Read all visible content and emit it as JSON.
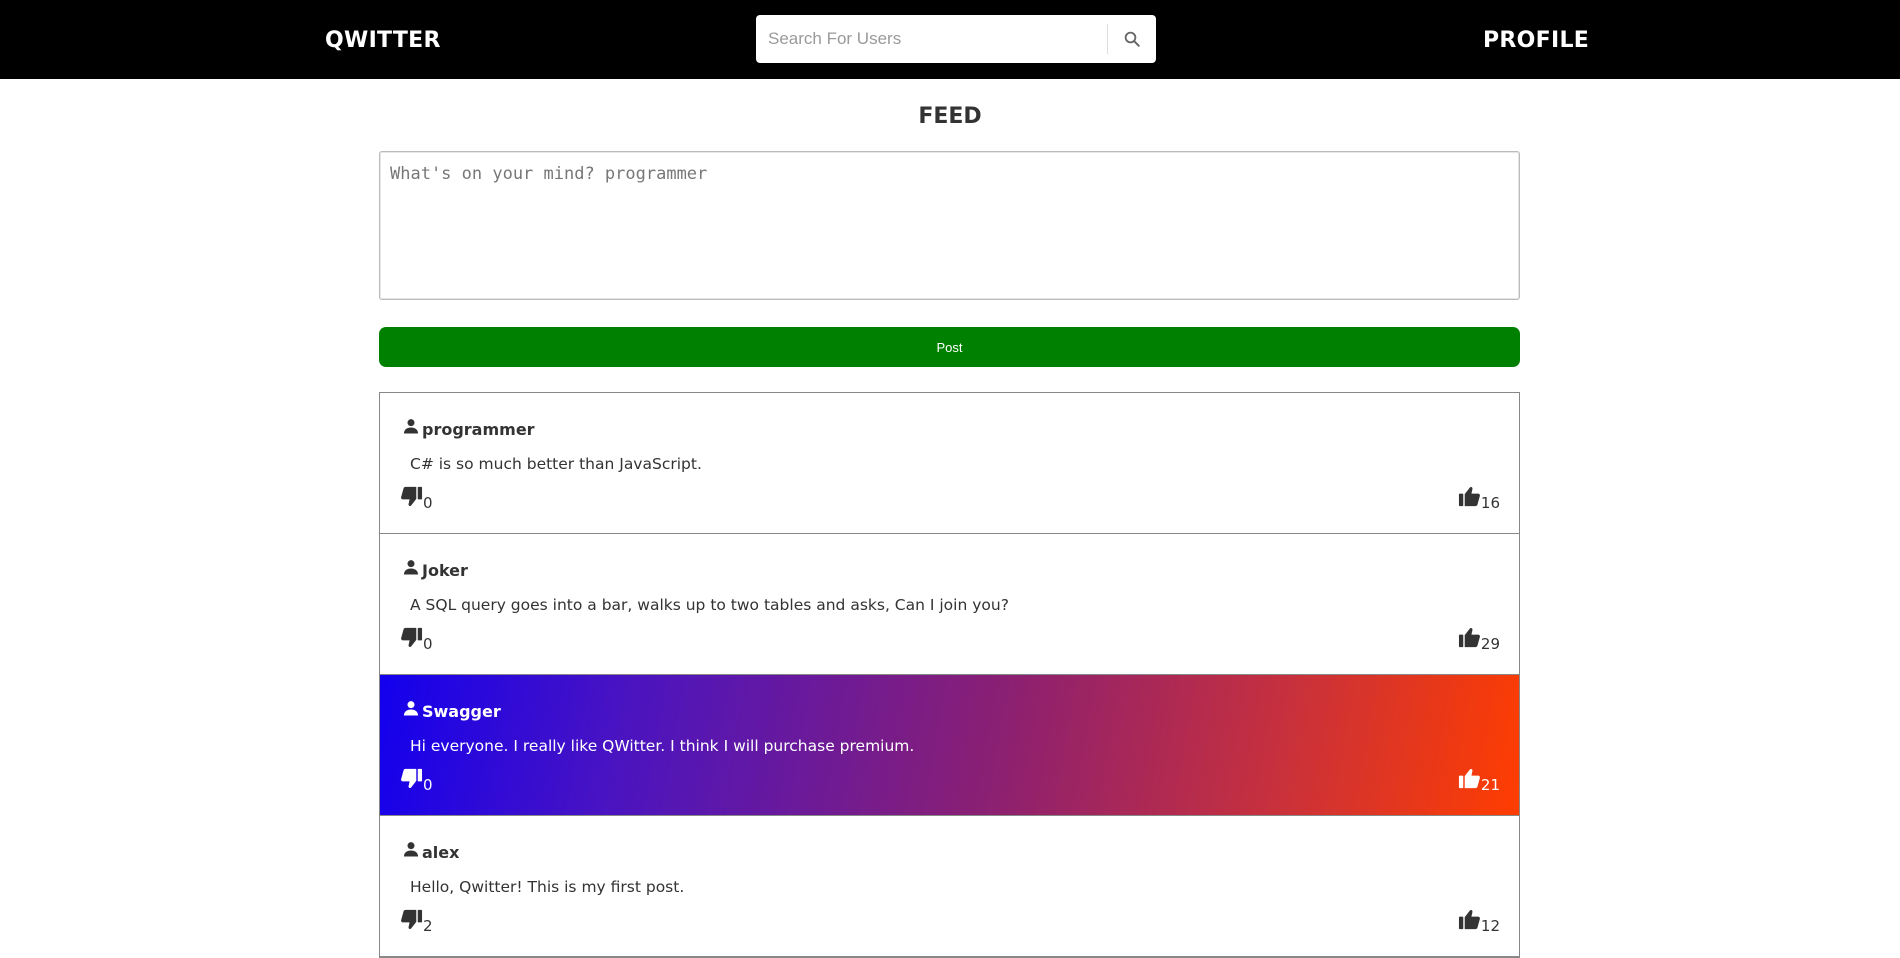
{
  "navbar": {
    "brand": "QWITTER",
    "profile_label": "PROFILE",
    "search_placeholder": "Search For Users",
    "search_icon": "search-icon"
  },
  "page": {
    "title": "FEED",
    "compose_placeholder": "What's on your mind? programmer",
    "post_button_label": "Post"
  },
  "posts": [
    {
      "username": "programmer",
      "text": "C# is so much better than JavaScript.",
      "dislikes": "0",
      "likes": "16",
      "premium": false
    },
    {
      "username": "Joker",
      "text": "A SQL query goes into a bar, walks up to two tables and asks, Can I join you?",
      "dislikes": "0",
      "likes": "29",
      "premium": false
    },
    {
      "username": "Swagger",
      "text": "Hi everyone. I really like QWitter. I think I will purchase premium.",
      "dislikes": "0",
      "likes": "21",
      "premium": true
    },
    {
      "username": "alex",
      "text": "Hello, Qwitter! This is my first post.",
      "dislikes": "2",
      "likes": "12",
      "premium": false
    }
  ],
  "colors": {
    "navbar": "#000000",
    "post_button": "#008000",
    "premium_gradient_start": "#1300ee",
    "premium_gradient_end": "#ff3d00"
  }
}
